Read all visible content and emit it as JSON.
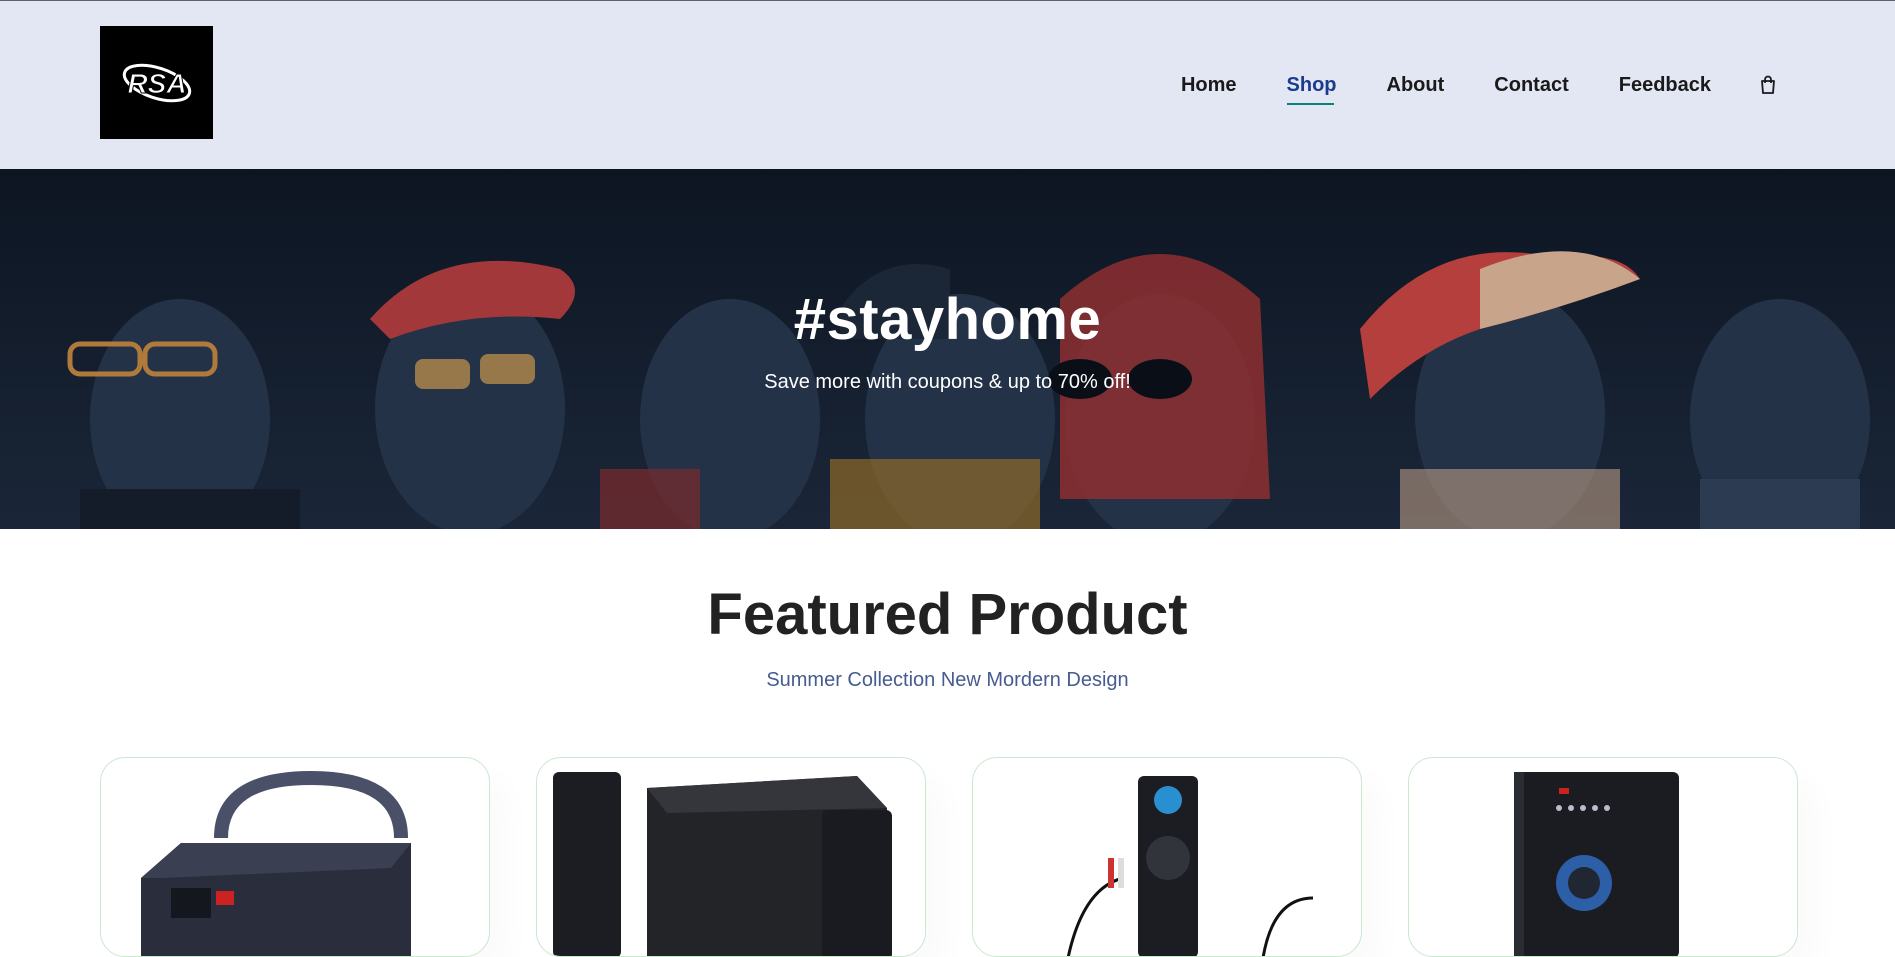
{
  "brand": {
    "logo_text": "RSA",
    "logo_alt": "rsa-logo"
  },
  "nav": {
    "items": [
      {
        "label": "Home",
        "active": false
      },
      {
        "label": "Shop",
        "active": true
      },
      {
        "label": "About",
        "active": false
      },
      {
        "label": "Contact",
        "active": false
      },
      {
        "label": "Feedback",
        "active": false
      }
    ],
    "cart_icon": "shopping-bag-icon"
  },
  "hero": {
    "title": "#stayhome",
    "subtitle": "Save more with coupons & up to 70% off!"
  },
  "featured": {
    "title": "Featured Product",
    "subtitle": "Summer Collection New Mordern Design"
  },
  "products": [
    {
      "image": "speaker-with-handle"
    },
    {
      "image": "tower-speaker-set"
    },
    {
      "image": "tower-speaker-with-cable"
    },
    {
      "image": "subwoofer-speaker"
    }
  ],
  "colors": {
    "header_bg": "#e3e6f3",
    "accent": "#088178",
    "hero_bg": "#101a29",
    "heading": "#222222",
    "subtitle": "#465b90"
  }
}
